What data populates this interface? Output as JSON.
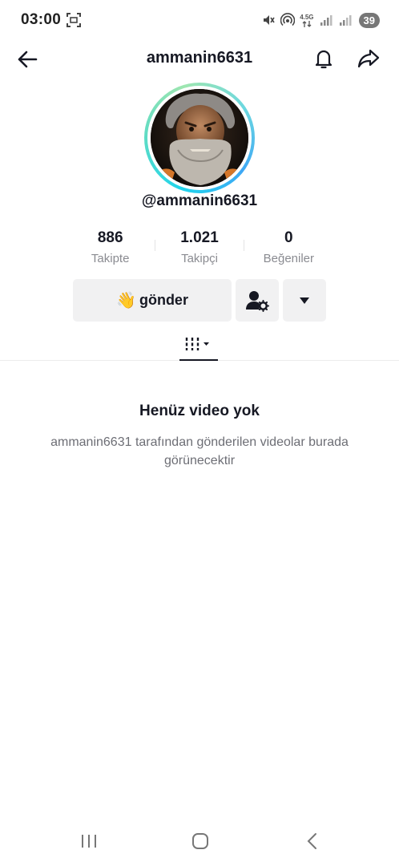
{
  "status_bar": {
    "time": "03:00",
    "network_label": "4.5G",
    "battery": "39"
  },
  "header": {
    "title": "ammanin6631"
  },
  "profile": {
    "handle": "@ammanin6631"
  },
  "stats": [
    {
      "value": "886",
      "label": "Takipte"
    },
    {
      "value": "1.021",
      "label": "Takipçi"
    },
    {
      "value": "0",
      "label": "Beğeniler"
    }
  ],
  "actions": {
    "wave_emoji": "👋",
    "send_label": "gönder"
  },
  "empty_state": {
    "title": "Henüz video yok",
    "description": "ammanin6631 tarafından gönderilen videolar burada görünecektir"
  },
  "icons": {
    "back": "arrow-left-icon",
    "bell": "bell-icon",
    "share": "share-arrow-icon",
    "friends": "user-settings-icon",
    "more": "caret-down-icon",
    "videos_tab": "videos-grid-icon"
  }
}
